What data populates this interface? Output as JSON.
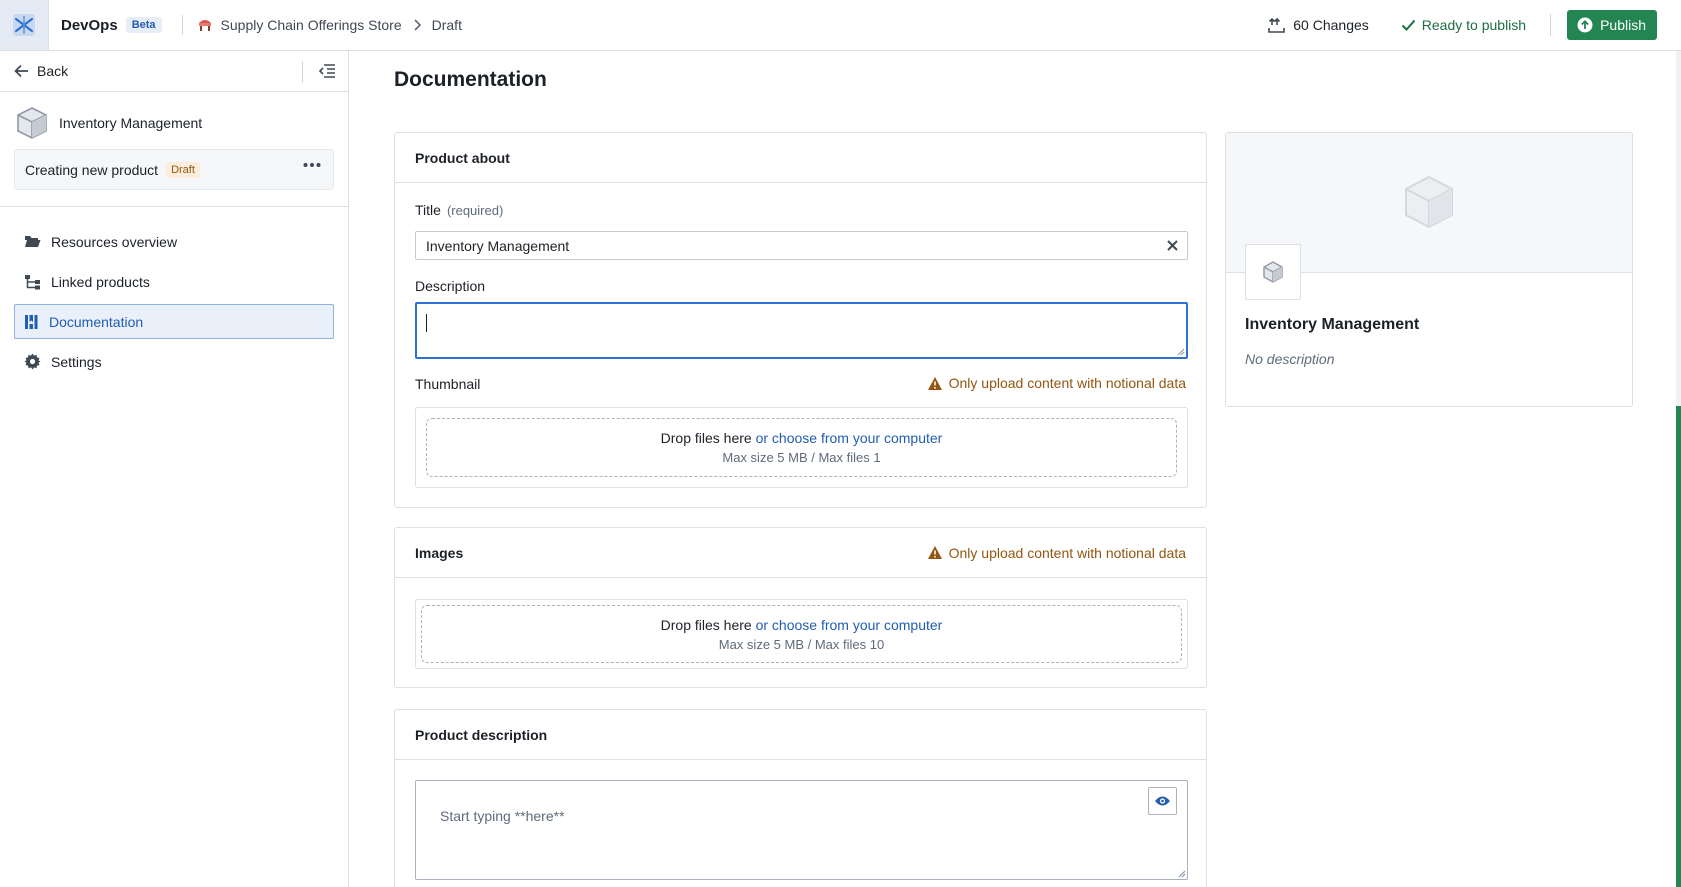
{
  "header": {
    "app_name": "DevOps",
    "beta_label": "Beta",
    "breadcrumb": [
      "Supply Chain Offerings Store",
      "Draft"
    ],
    "changes_label": "60 Changes",
    "ready_label": "Ready to publish",
    "publish_label": "Publish"
  },
  "sidebar": {
    "back_label": "Back",
    "product_name": "Inventory Management",
    "creating_label": "Creating new product",
    "draft_tag": "Draft",
    "nav": [
      {
        "label": "Resources overview",
        "icon": "folder-open-icon",
        "active": false
      },
      {
        "label": "Linked products",
        "icon": "hierarchy-icon",
        "active": false
      },
      {
        "label": "Documentation",
        "icon": "book-icon",
        "active": true
      },
      {
        "label": "Settings",
        "icon": "gear-icon",
        "active": false
      }
    ]
  },
  "main": {
    "page_title": "Documentation",
    "product_about": {
      "heading": "Product about",
      "title_label": "Title",
      "title_required": "(required)",
      "title_value": "Inventory Management",
      "description_label": "Description",
      "description_value": "",
      "thumbnail_label": "Thumbnail",
      "warning": "Only upload content with notional data",
      "drop_text": "Drop files here",
      "drop_link": "or choose from your computer",
      "drop_limits": "Max size 5 MB / Max files 1"
    },
    "images": {
      "heading": "Images",
      "warning": "Only upload content with notional data",
      "drop_text": "Drop files here",
      "drop_link": "or choose from your computer",
      "drop_limits": "Max size 5 MB / Max files 10"
    },
    "product_description": {
      "heading": "Product description",
      "placeholder": "Start typing **here**"
    }
  },
  "preview": {
    "title": "Inventory Management",
    "description": "No description"
  },
  "colors": {
    "accent": "#215db0",
    "publish_green": "#238551",
    "ready_green": "#1c6e42",
    "warning": "#935610"
  }
}
